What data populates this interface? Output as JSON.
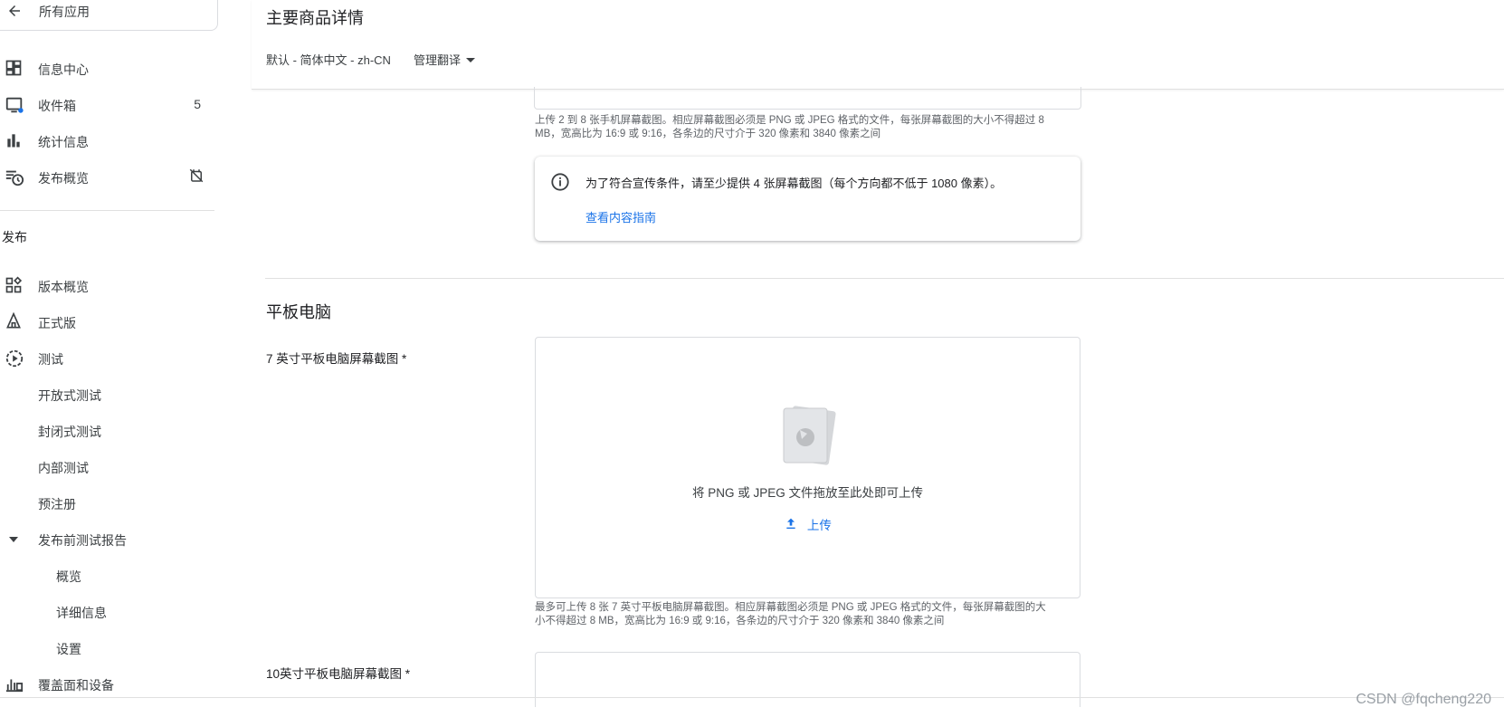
{
  "sidebar": {
    "back_label": "所有应用",
    "items": [
      {
        "label": "信息中心"
      },
      {
        "label": "收件箱",
        "badge": "5"
      },
      {
        "label": "统计信息"
      },
      {
        "label": "发布概览"
      }
    ],
    "section_release": "发布",
    "release_items": [
      {
        "label": "版本概览"
      },
      {
        "label": "正式版"
      },
      {
        "label": "测试"
      },
      {
        "label": "开放式测试"
      },
      {
        "label": "封闭式测试"
      },
      {
        "label": "内部测试"
      },
      {
        "label": "预注册"
      },
      {
        "label": "发布前测试报告"
      },
      {
        "label": "概览"
      },
      {
        "label": "详细信息"
      },
      {
        "label": "设置"
      },
      {
        "label": "覆盖面和设备"
      }
    ]
  },
  "header": {
    "title": "主要商品详情",
    "language": "默认 - 简体中文 - zh-CN",
    "manage_translation": "管理翻译"
  },
  "phone": {
    "helper_line1": "上传 2 到 8 张手机屏幕截图。相应屏幕截图必须是 PNG 或 JPEG 格式的文件，每张屏幕截图的大小不得超过 8",
    "helper_line2": "MB，宽高比为 16:9 或 9:16，各条边的尺寸介于 320 像素和 3840 像素之间",
    "info_message": "为了符合宣传条件，请至少提供 4 张屏幕截图（每个方向都不低于 1080 像素）。",
    "info_link": "查看内容指南"
  },
  "tablet": {
    "section_title": "平板电脑",
    "label_7inch": "7 英寸平板电脑屏幕截图 *",
    "dropzone_text": "将 PNG 或 JPEG 文件拖放至此处即可上传",
    "upload_label": "上传",
    "helper_line1": "最多可上传 8 张 7 英寸平板电脑屏幕截图。相应屏幕截图必须是 PNG 或 JPEG 格式的文件，每张屏幕截图的大",
    "helper_line2": "小不得超过 8 MB，宽高比为 16:9 或 9:16，各条边的尺寸介于 320 像素和 3840 像素之间",
    "label_10inch": "10英寸平板电脑屏幕截图 *"
  },
  "watermark": "CSDN @fqcheng220",
  "colors": {
    "accent": "#1a73e8",
    "text": "#202124",
    "muted": "#5f6368",
    "border": "#dadce0"
  }
}
